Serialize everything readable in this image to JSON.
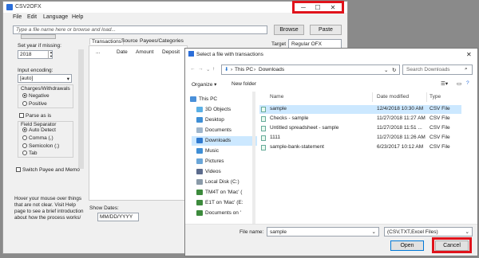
{
  "main": {
    "title": "CSV2OFX",
    "window_controls": {
      "minimize": "─",
      "maximize": "☐",
      "close": "✕"
    },
    "menu": [
      "File",
      "Edit",
      "Language",
      "Help"
    ],
    "file_input_placeholder": "Type a file name here or browse and load...",
    "browse_label": "Browse",
    "paste_label": "Paste",
    "target_label": "Target",
    "target_value": "Regular OFX",
    "set_year_label": "Set year if missing:",
    "year_value": "2018",
    "input_encoding_label": "Input encoding:",
    "encoding_value": "[auto]",
    "charges_label": "Charges/Withdrawals",
    "charges_options": [
      {
        "label": "Negative",
        "selected": true
      },
      {
        "label": "Positive",
        "selected": false
      }
    ],
    "parse_as_is_label": "Parse as is",
    "field_separator_label": "Field Separator",
    "separator_options": [
      {
        "label": "Auto Detect",
        "selected": true
      },
      {
        "label": "Comma (,)",
        "selected": false
      },
      {
        "label": "Semicolon (;)",
        "selected": false
      },
      {
        "label": "Tab",
        "selected": false
      }
    ],
    "switch_label": "Switch Payee and Memo",
    "help_text": [
      "Hover your mouse over things",
      "that are not clear. Visit Help",
      "page to see a brief introduction",
      "about how the process works/"
    ],
    "show_dates_label": "Show Dates:",
    "show_dates_value": "MM/DD/YYYY",
    "tabs": [
      "Transactions",
      "Source",
      "Payees/Categories"
    ],
    "columns": [
      "...",
      "Date",
      "Amount",
      "Deposit"
    ]
  },
  "dialog": {
    "title": "Select a file with transactions",
    "close": "✕",
    "path": [
      "This PC",
      "Downloads"
    ],
    "search_placeholder": "Search Downloads",
    "organize_label": "Organize ▾",
    "new_folder_label": "New folder",
    "nav_items": [
      {
        "label": "This PC",
        "icon": "computer-icon",
        "color": "#4a90d9"
      },
      {
        "label": "3D Objects",
        "icon": "cube-icon",
        "color": "#5ab0e6"
      },
      {
        "label": "Desktop",
        "icon": "desktop-icon",
        "color": "#3f8fd6"
      },
      {
        "label": "Documents",
        "icon": "document-icon",
        "color": "#9fb6cc"
      },
      {
        "label": "Downloads",
        "icon": "download-icon",
        "color": "#2f7ad0"
      },
      {
        "label": "Music",
        "icon": "music-icon",
        "color": "#3f8fd6"
      },
      {
        "label": "Pictures",
        "icon": "picture-icon",
        "color": "#6aa6d8"
      },
      {
        "label": "Videos",
        "icon": "video-icon",
        "color": "#5b6b8c"
      },
      {
        "label": "Local Disk (C:)",
        "icon": "disk-icon",
        "color": "#8a9aa8"
      },
      {
        "label": "TM4T on 'Mac' (",
        "icon": "network-drive-icon",
        "color": "#3c8a3c"
      },
      {
        "label": "E1T on 'Mac' (E:",
        "icon": "network-drive-icon",
        "color": "#3c8a3c"
      },
      {
        "label": "Documents on '",
        "icon": "network-drive-icon",
        "color": "#3c8a3c"
      }
    ],
    "headers": [
      "Name",
      "Date modified",
      "Type"
    ],
    "files": [
      {
        "name": "sample",
        "date": "12/4/2018 10:30 AM",
        "type": "CSV File"
      },
      {
        "name": "Checks - sample",
        "date": "11/27/2018 11:27 AM",
        "type": "CSV File"
      },
      {
        "name": "Untitled spreadsheet - sample",
        "date": "11/27/2018 11:51 ...",
        "type": "CSV File"
      },
      {
        "name": "1111",
        "date": "11/27/2018 11:26 AM",
        "type": "CSV File"
      },
      {
        "name": "sample-bank-statement",
        "date": "6/23/2017 10:12 AM",
        "type": "CSV File"
      }
    ],
    "file_name_label": "File name:",
    "file_name_value": "sample",
    "file_type_value": "(CSV,TXT,Excel Files)",
    "open_label": "Open",
    "cancel_label": "Cancel"
  },
  "colors": {
    "highlight": "#e0131b",
    "selection": "#cce8ff",
    "accent": "#0078d7"
  }
}
